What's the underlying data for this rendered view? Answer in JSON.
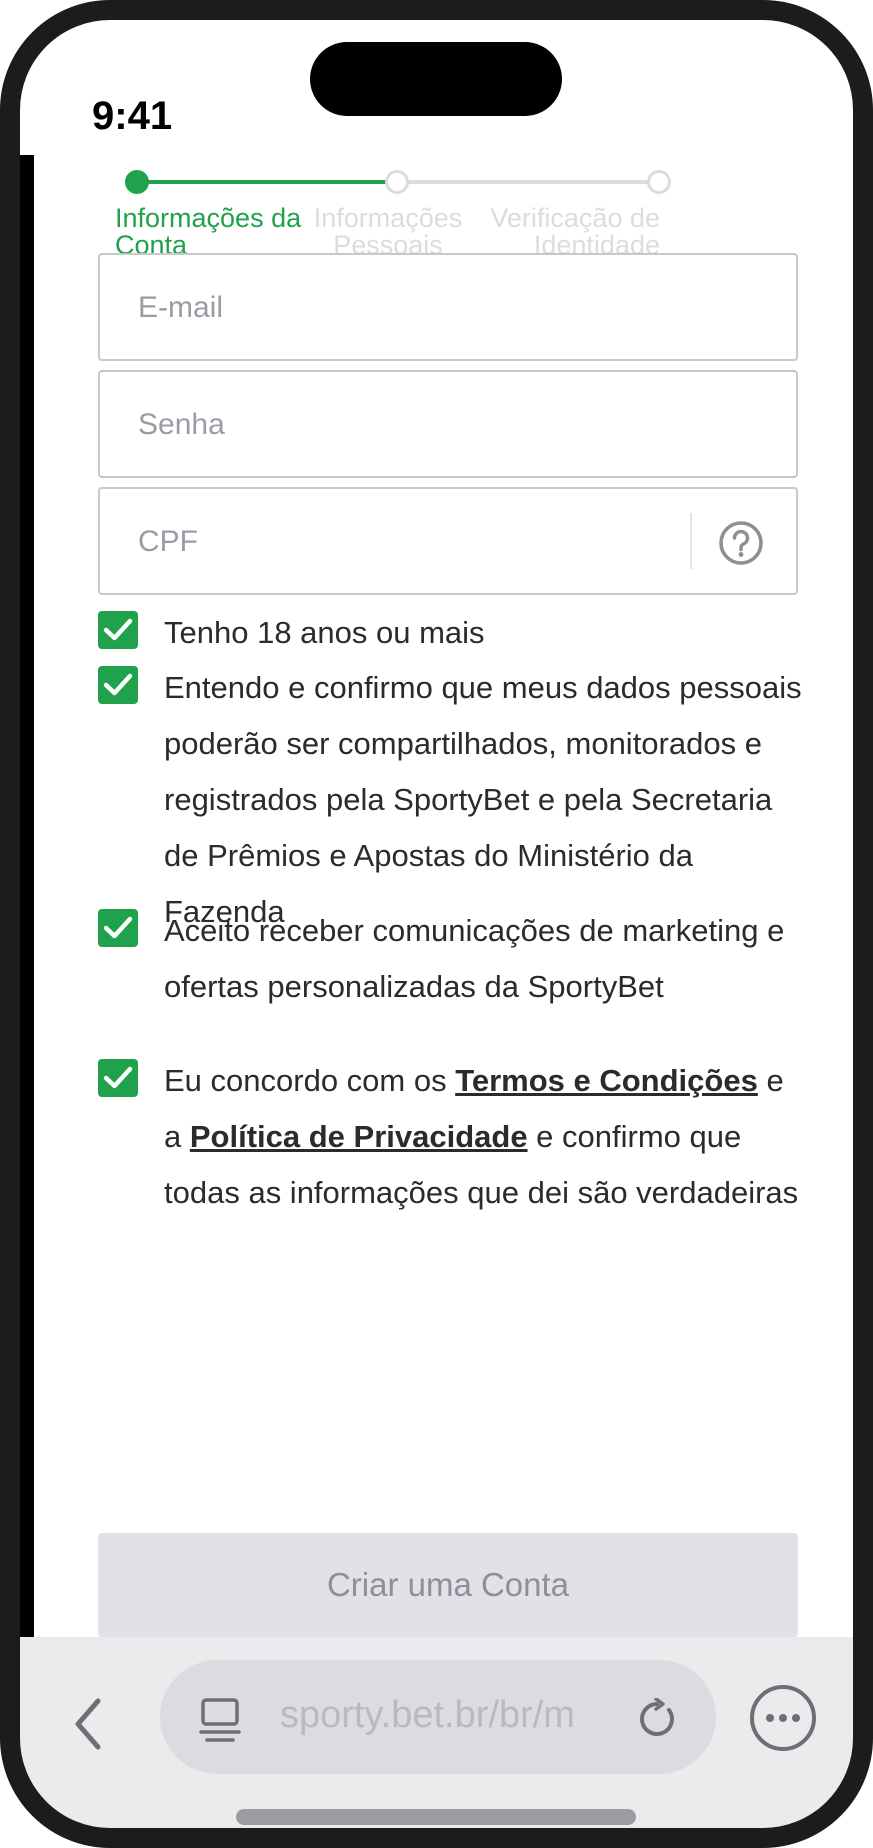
{
  "status_bar": {
    "time": "9:41"
  },
  "stepper": {
    "steps": [
      {
        "label_line1": "Informações da",
        "label_line2": "Conta",
        "state": "active"
      },
      {
        "label_line1": "Informações",
        "label_line2": "Pessoais",
        "state": "inactive"
      },
      {
        "label_line1": "Verificação de",
        "label_line2": "Identidade",
        "state": "inactive"
      }
    ],
    "colors": {
      "active": "#1fa24b",
      "inactive": "#dcdce0"
    }
  },
  "form": {
    "email": {
      "placeholder": "E-mail",
      "value": ""
    },
    "password": {
      "placeholder": "Senha",
      "value": ""
    },
    "cpf": {
      "placeholder": "CPF",
      "value": "",
      "help_icon": "question-circle-icon"
    }
  },
  "checkboxes": [
    {
      "checked": true,
      "text": "Tenho 18 anos ou mais"
    },
    {
      "checked": true,
      "text": "Entendo e confirmo que meus dados pessoais poderão ser compartilhados, monitorados e registrados pela SportyBet e pela Secretaria de Prêmios e Apostas do Ministério da Fazenda"
    },
    {
      "checked": true,
      "text": "Aceito receber comunicações de marketing e ofertas personalizadas da SportyBet"
    },
    {
      "checked": true,
      "text_before": "Eu concordo com os ",
      "link1": "Termos e Condições",
      "text_middle": " e a ",
      "link2": "Política de Privacidade",
      "text_after": " e confirmo que todas as informações que dei são verdadeiras"
    }
  ],
  "create_button": {
    "label": "Criar uma Conta"
  },
  "browser": {
    "url": "sporty.bet.br/br/m",
    "icons": [
      "chevron-left-icon",
      "tab-icon",
      "reload-icon",
      "more-icon"
    ]
  },
  "theme": {
    "accent": "#1fa24b"
  }
}
